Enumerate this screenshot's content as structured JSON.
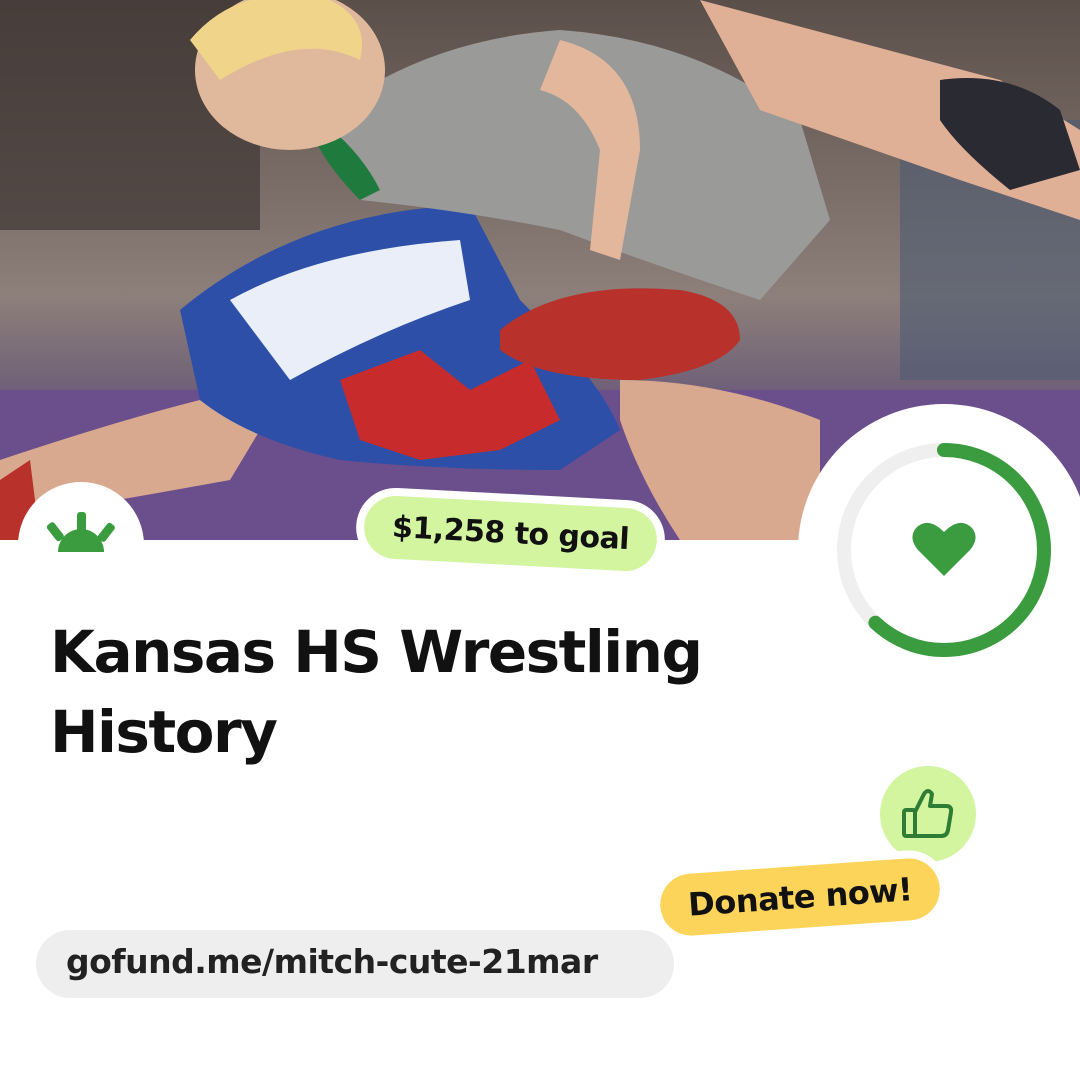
{
  "hero": {
    "image_description_icon": "wrestling-photo"
  },
  "brand": {
    "logo_icon": "gofundme-sunrise-icon",
    "accent": "#3a9c3f"
  },
  "goal_badge": {
    "label": "$1,258 to goal",
    "color": "#d3f5a0"
  },
  "progress": {
    "fraction": 0.62,
    "icon": "heart-icon",
    "color": "#3a9c3f",
    "track_color": "#efefef"
  },
  "campaign": {
    "title": "Kansas HS Wrestling History"
  },
  "donate": {
    "label": "Donate now!",
    "icon": "thumbs-up-icon",
    "color": "#fcd45a"
  },
  "share": {
    "url": "gofund.me/mitch-cute-21mar"
  }
}
